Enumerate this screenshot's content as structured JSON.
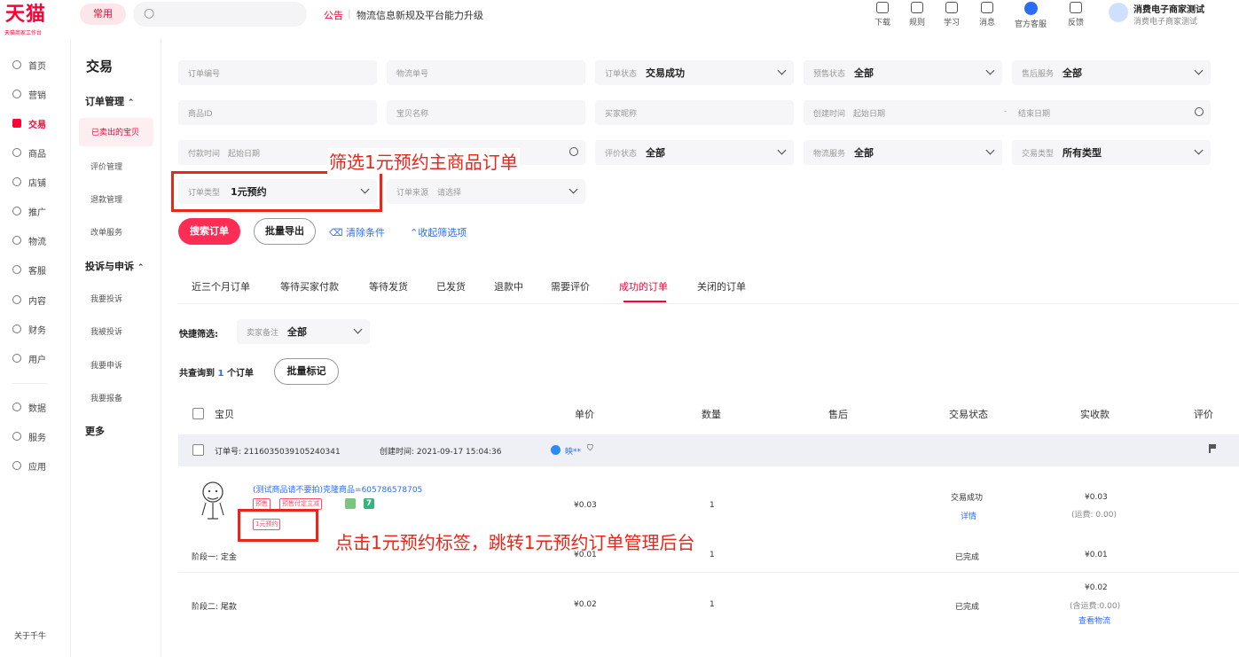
{
  "topbar": {
    "logo": "天猫",
    "logo_sub": "天猫商家工作台",
    "common_btn": "常用",
    "notice_tag": "公告",
    "notice_text": "物流信息新规及平台能力升级",
    "tools": [
      {
        "label": "下载",
        "icon": "download-icon"
      },
      {
        "label": "规则",
        "icon": "rules-icon"
      },
      {
        "label": "学习",
        "icon": "learn-icon"
      },
      {
        "label": "消息",
        "icon": "message-icon"
      },
      {
        "label": "官方客服",
        "icon": "service-icon"
      },
      {
        "label": "反馈",
        "icon": "feedback-icon"
      }
    ],
    "user_name": "消费电子商家测试",
    "user_sub": "消费电子商家测试"
  },
  "leftnav": {
    "items": [
      "首页",
      "营销",
      "交易",
      "商品",
      "店铺",
      "推广",
      "物流",
      "客服",
      "内容",
      "财务",
      "用户",
      "数据",
      "服务",
      "应用"
    ],
    "active": "交易",
    "about": "关于千牛"
  },
  "subnav": {
    "title": "交易",
    "group1": "订单管理",
    "group1_items": [
      "已卖出的宝贝",
      "评价管理",
      "退款管理",
      "改单服务"
    ],
    "group2": "投诉与申诉",
    "group2_items": [
      "我要投诉",
      "我被投诉",
      "我要申诉",
      "我要报备"
    ],
    "more": "更多"
  },
  "filters": {
    "order_no": "订单编号",
    "logistics_no": "物流单号",
    "order_status_label": "订单状态",
    "order_status": "交易成功",
    "presale_label": "预售状态",
    "presale": "全部",
    "aftersale_label": "售后服务",
    "aftersale": "全部",
    "item_id": "商品ID",
    "item_name": "宝贝名称",
    "buyer_nick": "买家昵称",
    "created_label": "创建时间",
    "start_date": "起始日期",
    "end_date": "结束日期",
    "pay_time_label": "付款时间",
    "pay_start": "起始日期",
    "review_label": "评价状态",
    "review": "全部",
    "logistics_service_label": "物流服务",
    "logistics_service": "全部",
    "trade_type_label": "交易类型",
    "trade_type": "所有类型",
    "order_type_label": "订单类型",
    "order_type": "1元预约",
    "order_source_label": "订单来源",
    "order_source": "请选择"
  },
  "actions": {
    "search": "搜索订单",
    "export": "批量导出",
    "clear": "清除条件",
    "collapse": "收起筛选项"
  },
  "tabs": [
    "近三个月订单",
    "等待买家付款",
    "等待发货",
    "已发货",
    "退款中",
    "需要评价",
    "成功的订单",
    "关闭的订单"
  ],
  "active_tab": "成功的订单",
  "quick": {
    "label": "快捷筛选:",
    "remark_label": "卖家备注",
    "remark": "全部"
  },
  "result": {
    "prefix": "共查询到",
    "count": "1",
    "suffix": "个订单",
    "batch_mark": "批量标记"
  },
  "table_headers": [
    "宝贝",
    "单价",
    "数量",
    "售后",
    "交易状态",
    "实收款",
    "评价"
  ],
  "order": {
    "order_no": "订单号: 2116035039105240341",
    "created": "创建时间: 2021-09-17 15:04:36",
    "buyer": "映**",
    "item_title": "(测试商品请不要拍)克隆商品=605786578705",
    "tags": [
      "预售",
      "预售付定立减"
    ],
    "tag_7": "7",
    "yuan_tag": "1元预约",
    "unit_price": "¥0.03",
    "qty": "1",
    "status": "交易成功",
    "detail_link": "详情",
    "received": "¥0.03",
    "freight": "(运费: 0.00)",
    "stage1_label": "阶段一: 定金",
    "stage1_price": "¥0.01",
    "stage1_qty": "1",
    "stage1_status": "已完成",
    "stage1_received": "¥0.01",
    "stage2_label": "阶段二: 尾款",
    "stage2_price": "¥0.02",
    "stage2_qty": "1",
    "stage2_status": "已完成",
    "stage2_received": "¥0.02",
    "stage2_freight": "(含运费:0.00)",
    "logistics_link": "查看物流"
  },
  "annotations": {
    "filter_note": "筛选1元预约主商品订单",
    "click_note": "点击1元预约标签，跳转1元预约订单管理后台"
  },
  "colors": {
    "brand": "#ff0036",
    "annotation": "#e8261a",
    "link": "#2b6cf5"
  }
}
